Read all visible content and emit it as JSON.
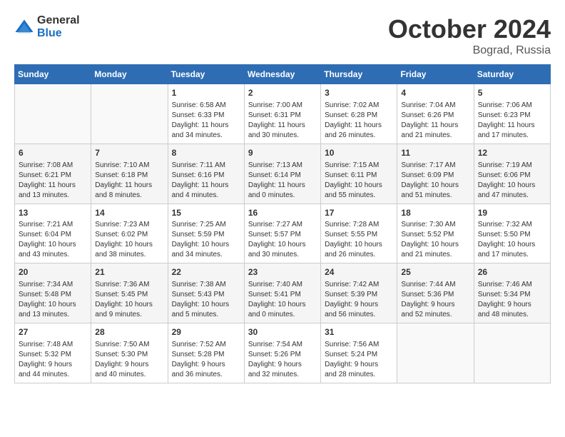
{
  "logo": {
    "general": "General",
    "blue": "Blue"
  },
  "header": {
    "month": "October 2024",
    "location": "Bograd, Russia"
  },
  "weekdays": [
    "Sunday",
    "Monday",
    "Tuesday",
    "Wednesday",
    "Thursday",
    "Friday",
    "Saturday"
  ],
  "weeks": [
    [
      {
        "day": "",
        "info": ""
      },
      {
        "day": "",
        "info": ""
      },
      {
        "day": "1",
        "info": "Sunrise: 6:58 AM\nSunset: 6:33 PM\nDaylight: 11 hours\nand 34 minutes."
      },
      {
        "day": "2",
        "info": "Sunrise: 7:00 AM\nSunset: 6:31 PM\nDaylight: 11 hours\nand 30 minutes."
      },
      {
        "day": "3",
        "info": "Sunrise: 7:02 AM\nSunset: 6:28 PM\nDaylight: 11 hours\nand 26 minutes."
      },
      {
        "day": "4",
        "info": "Sunrise: 7:04 AM\nSunset: 6:26 PM\nDaylight: 11 hours\nand 21 minutes."
      },
      {
        "day": "5",
        "info": "Sunrise: 7:06 AM\nSunset: 6:23 PM\nDaylight: 11 hours\nand 17 minutes."
      }
    ],
    [
      {
        "day": "6",
        "info": "Sunrise: 7:08 AM\nSunset: 6:21 PM\nDaylight: 11 hours\nand 13 minutes."
      },
      {
        "day": "7",
        "info": "Sunrise: 7:10 AM\nSunset: 6:18 PM\nDaylight: 11 hours\nand 8 minutes."
      },
      {
        "day": "8",
        "info": "Sunrise: 7:11 AM\nSunset: 6:16 PM\nDaylight: 11 hours\nand 4 minutes."
      },
      {
        "day": "9",
        "info": "Sunrise: 7:13 AM\nSunset: 6:14 PM\nDaylight: 11 hours\nand 0 minutes."
      },
      {
        "day": "10",
        "info": "Sunrise: 7:15 AM\nSunset: 6:11 PM\nDaylight: 10 hours\nand 55 minutes."
      },
      {
        "day": "11",
        "info": "Sunrise: 7:17 AM\nSunset: 6:09 PM\nDaylight: 10 hours\nand 51 minutes."
      },
      {
        "day": "12",
        "info": "Sunrise: 7:19 AM\nSunset: 6:06 PM\nDaylight: 10 hours\nand 47 minutes."
      }
    ],
    [
      {
        "day": "13",
        "info": "Sunrise: 7:21 AM\nSunset: 6:04 PM\nDaylight: 10 hours\nand 43 minutes."
      },
      {
        "day": "14",
        "info": "Sunrise: 7:23 AM\nSunset: 6:02 PM\nDaylight: 10 hours\nand 38 minutes."
      },
      {
        "day": "15",
        "info": "Sunrise: 7:25 AM\nSunset: 5:59 PM\nDaylight: 10 hours\nand 34 minutes."
      },
      {
        "day": "16",
        "info": "Sunrise: 7:27 AM\nSunset: 5:57 PM\nDaylight: 10 hours\nand 30 minutes."
      },
      {
        "day": "17",
        "info": "Sunrise: 7:28 AM\nSunset: 5:55 PM\nDaylight: 10 hours\nand 26 minutes."
      },
      {
        "day": "18",
        "info": "Sunrise: 7:30 AM\nSunset: 5:52 PM\nDaylight: 10 hours\nand 21 minutes."
      },
      {
        "day": "19",
        "info": "Sunrise: 7:32 AM\nSunset: 5:50 PM\nDaylight: 10 hours\nand 17 minutes."
      }
    ],
    [
      {
        "day": "20",
        "info": "Sunrise: 7:34 AM\nSunset: 5:48 PM\nDaylight: 10 hours\nand 13 minutes."
      },
      {
        "day": "21",
        "info": "Sunrise: 7:36 AM\nSunset: 5:45 PM\nDaylight: 10 hours\nand 9 minutes."
      },
      {
        "day": "22",
        "info": "Sunrise: 7:38 AM\nSunset: 5:43 PM\nDaylight: 10 hours\nand 5 minutes."
      },
      {
        "day": "23",
        "info": "Sunrise: 7:40 AM\nSunset: 5:41 PM\nDaylight: 10 hours\nand 0 minutes."
      },
      {
        "day": "24",
        "info": "Sunrise: 7:42 AM\nSunset: 5:39 PM\nDaylight: 9 hours\nand 56 minutes."
      },
      {
        "day": "25",
        "info": "Sunrise: 7:44 AM\nSunset: 5:36 PM\nDaylight: 9 hours\nand 52 minutes."
      },
      {
        "day": "26",
        "info": "Sunrise: 7:46 AM\nSunset: 5:34 PM\nDaylight: 9 hours\nand 48 minutes."
      }
    ],
    [
      {
        "day": "27",
        "info": "Sunrise: 7:48 AM\nSunset: 5:32 PM\nDaylight: 9 hours\nand 44 minutes."
      },
      {
        "day": "28",
        "info": "Sunrise: 7:50 AM\nSunset: 5:30 PM\nDaylight: 9 hours\nand 40 minutes."
      },
      {
        "day": "29",
        "info": "Sunrise: 7:52 AM\nSunset: 5:28 PM\nDaylight: 9 hours\nand 36 minutes."
      },
      {
        "day": "30",
        "info": "Sunrise: 7:54 AM\nSunset: 5:26 PM\nDaylight: 9 hours\nand 32 minutes."
      },
      {
        "day": "31",
        "info": "Sunrise: 7:56 AM\nSunset: 5:24 PM\nDaylight: 9 hours\nand 28 minutes."
      },
      {
        "day": "",
        "info": ""
      },
      {
        "day": "",
        "info": ""
      }
    ]
  ]
}
